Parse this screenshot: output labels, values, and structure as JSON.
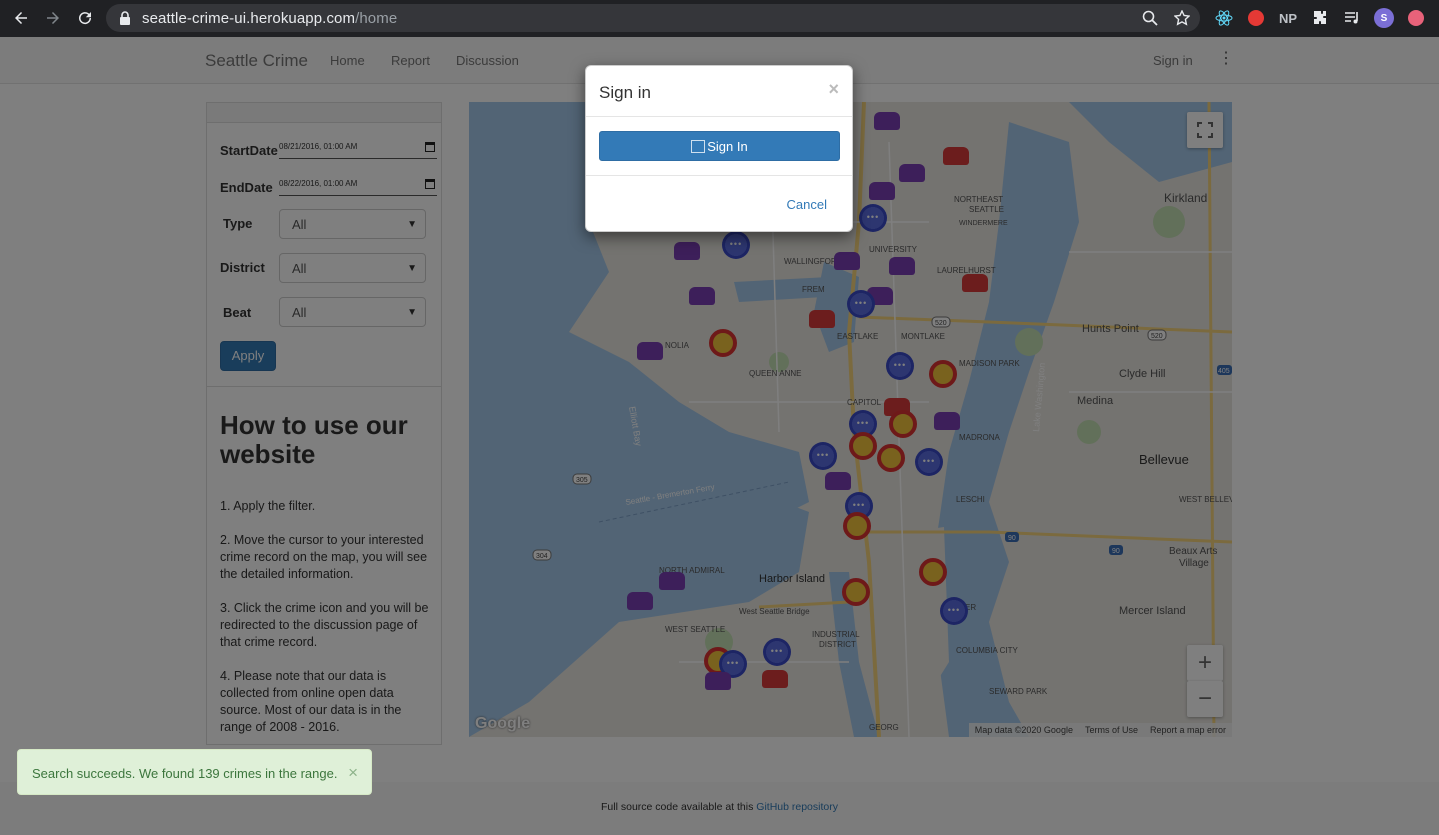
{
  "browser": {
    "url_domain": "seattle-crime-ui.herokuapp.com",
    "url_path": "/home",
    "profile_initial": "S",
    "ext_np": "NP"
  },
  "navbar": {
    "brand": "Seattle Crime",
    "links": [
      "Home",
      "Report",
      "Discussion"
    ],
    "sign_in": "Sign in"
  },
  "filters": {
    "start_label": "StartDate",
    "start_value": "08/21/2016, 01:00 AM",
    "end_label": "EndDate",
    "end_value": "08/22/2016, 01:00 AM",
    "type_label": "Type",
    "type_value": "All",
    "district_label": "District",
    "district_value": "All",
    "beat_label": "Beat",
    "beat_value": "All",
    "apply": "Apply"
  },
  "howto": {
    "title": "How to use our website",
    "steps": [
      "1. Apply the filter.",
      "2. Move the cursor to your interested crime record on the map, you will see the detailed information.",
      "3. Click the crime icon and you will be redirected to the discussion page of that crime record.",
      "4. Please note that our data is collected from online open data source. Most of our data is in the range of 2008 - 2016."
    ]
  },
  "map": {
    "labels": {
      "kirkland": "Kirkland",
      "northeast": "NORTHEAST",
      "seattle": "SEATTLE",
      "windermere": "WINDERMERE",
      "laurelhurst": "LAURELHURST",
      "wallingford": "WALLINGFORD",
      "university": "UNIVERSITY",
      "fremont": "FREM",
      "hunts_point": "Hunts Point",
      "clyde_hill": "Clyde Hill",
      "medina": "Medina",
      "bellevue": "Bellevue",
      "west_bellevue": "WEST BELLEV",
      "eastlake": "EASTLAKE",
      "montlake": "MONTLAKE",
      "madison_park": "MADISON PARK",
      "queen_anne": "QUEEN ANNE",
      "magnolia": "NOLIA",
      "capitol": "CAPITOL",
      "madrona": "MADRONA",
      "leschi": "LESCHI",
      "elliott_bay": "Elliott Bay",
      "lake_washington": "Lake Washington",
      "ferry": "Seattle - Bremerton Ferry",
      "harbor_island": "Harbor Island",
      "west_seattle_bridge": "West Seattle Bridge",
      "north_admiral": "NORTH ADMIRAL",
      "west_seattle": "WEST SEATTLE",
      "industrial": "INDUSTRIAL",
      "district": "DISTRICT",
      "columbia_city": "COLUMBIA CITY",
      "seward_park": "SEWARD PARK",
      "mercer_island": "Mercer Island",
      "beaux_arts": "Beaux Arts",
      "village": "Village",
      "baker": "BAKER",
      "georg": "GEORG",
      "rt305": "305",
      "rt304": "304",
      "rt520a": "520",
      "rt520b": "520",
      "rt90a": "90",
      "rt90b": "90",
      "rt405": "405"
    },
    "google": "Google",
    "attribution": [
      "Map data ©2020 Google",
      "Terms of Use",
      "Report a map error"
    ],
    "zoom_in": "+",
    "zoom_out": "−"
  },
  "modal": {
    "title": "Sign in",
    "close": "×",
    "button": "Sign In",
    "cancel": "Cancel"
  },
  "footer": {
    "text": "Full source code available at this",
    "link": "GitHub repository"
  },
  "toast": {
    "message": "Search succeeds. We found 139 crimes in the range.",
    "close": "×"
  }
}
